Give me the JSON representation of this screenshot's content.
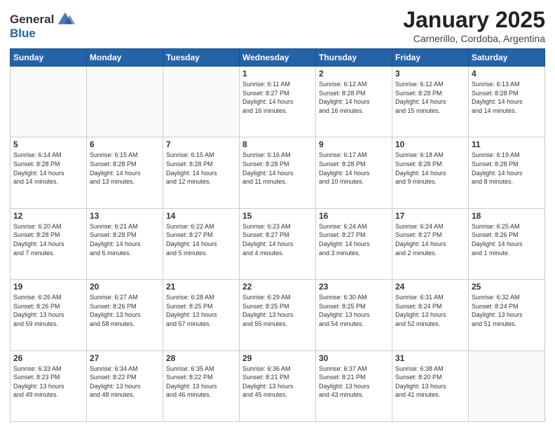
{
  "header": {
    "logo_line1": "General",
    "logo_line2": "Blue",
    "title": "January 2025",
    "subtitle": "Carnerillo, Cordoba, Argentina"
  },
  "weekdays": [
    "Sunday",
    "Monday",
    "Tuesday",
    "Wednesday",
    "Thursday",
    "Friday",
    "Saturday"
  ],
  "weeks": [
    [
      {
        "day": "",
        "info": ""
      },
      {
        "day": "",
        "info": ""
      },
      {
        "day": "",
        "info": ""
      },
      {
        "day": "1",
        "info": "Sunrise: 6:11 AM\nSunset: 8:27 PM\nDaylight: 14 hours\nand 16 minutes."
      },
      {
        "day": "2",
        "info": "Sunrise: 6:12 AM\nSunset: 8:28 PM\nDaylight: 14 hours\nand 16 minutes."
      },
      {
        "day": "3",
        "info": "Sunrise: 6:12 AM\nSunset: 8:28 PM\nDaylight: 14 hours\nand 15 minutes."
      },
      {
        "day": "4",
        "info": "Sunrise: 6:13 AM\nSunset: 8:28 PM\nDaylight: 14 hours\nand 14 minutes."
      }
    ],
    [
      {
        "day": "5",
        "info": "Sunrise: 6:14 AM\nSunset: 8:28 PM\nDaylight: 14 hours\nand 14 minutes."
      },
      {
        "day": "6",
        "info": "Sunrise: 6:15 AM\nSunset: 8:28 PM\nDaylight: 14 hours\nand 13 minutes."
      },
      {
        "day": "7",
        "info": "Sunrise: 6:15 AM\nSunset: 8:28 PM\nDaylight: 14 hours\nand 12 minutes."
      },
      {
        "day": "8",
        "info": "Sunrise: 6:16 AM\nSunset: 8:28 PM\nDaylight: 14 hours\nand 11 minutes."
      },
      {
        "day": "9",
        "info": "Sunrise: 6:17 AM\nSunset: 8:28 PM\nDaylight: 14 hours\nand 10 minutes."
      },
      {
        "day": "10",
        "info": "Sunrise: 6:18 AM\nSunset: 8:28 PM\nDaylight: 14 hours\nand 9 minutes."
      },
      {
        "day": "11",
        "info": "Sunrise: 6:19 AM\nSunset: 8:28 PM\nDaylight: 14 hours\nand 8 minutes."
      }
    ],
    [
      {
        "day": "12",
        "info": "Sunrise: 6:20 AM\nSunset: 8:28 PM\nDaylight: 14 hours\nand 7 minutes."
      },
      {
        "day": "13",
        "info": "Sunrise: 6:21 AM\nSunset: 8:28 PM\nDaylight: 14 hours\nand 6 minutes."
      },
      {
        "day": "14",
        "info": "Sunrise: 6:22 AM\nSunset: 8:27 PM\nDaylight: 14 hours\nand 5 minutes."
      },
      {
        "day": "15",
        "info": "Sunrise: 6:23 AM\nSunset: 8:27 PM\nDaylight: 14 hours\nand 4 minutes."
      },
      {
        "day": "16",
        "info": "Sunrise: 6:24 AM\nSunset: 8:27 PM\nDaylight: 14 hours\nand 3 minutes."
      },
      {
        "day": "17",
        "info": "Sunrise: 6:24 AM\nSunset: 8:27 PM\nDaylight: 14 hours\nand 2 minutes."
      },
      {
        "day": "18",
        "info": "Sunrise: 6:25 AM\nSunset: 8:26 PM\nDaylight: 14 hours\nand 1 minute."
      }
    ],
    [
      {
        "day": "19",
        "info": "Sunrise: 6:26 AM\nSunset: 8:26 PM\nDaylight: 13 hours\nand 59 minutes."
      },
      {
        "day": "20",
        "info": "Sunrise: 6:27 AM\nSunset: 8:26 PM\nDaylight: 13 hours\nand 58 minutes."
      },
      {
        "day": "21",
        "info": "Sunrise: 6:28 AM\nSunset: 8:25 PM\nDaylight: 13 hours\nand 57 minutes."
      },
      {
        "day": "22",
        "info": "Sunrise: 6:29 AM\nSunset: 8:25 PM\nDaylight: 13 hours\nand 55 minutes."
      },
      {
        "day": "23",
        "info": "Sunrise: 6:30 AM\nSunset: 8:25 PM\nDaylight: 13 hours\nand 54 minutes."
      },
      {
        "day": "24",
        "info": "Sunrise: 6:31 AM\nSunset: 8:24 PM\nDaylight: 13 hours\nand 52 minutes."
      },
      {
        "day": "25",
        "info": "Sunrise: 6:32 AM\nSunset: 8:24 PM\nDaylight: 13 hours\nand 51 minutes."
      }
    ],
    [
      {
        "day": "26",
        "info": "Sunrise: 6:33 AM\nSunset: 8:23 PM\nDaylight: 13 hours\nand 49 minutes."
      },
      {
        "day": "27",
        "info": "Sunrise: 6:34 AM\nSunset: 8:22 PM\nDaylight: 13 hours\nand 48 minutes."
      },
      {
        "day": "28",
        "info": "Sunrise: 6:35 AM\nSunset: 8:22 PM\nDaylight: 13 hours\nand 46 minutes."
      },
      {
        "day": "29",
        "info": "Sunrise: 6:36 AM\nSunset: 8:21 PM\nDaylight: 13 hours\nand 45 minutes."
      },
      {
        "day": "30",
        "info": "Sunrise: 6:37 AM\nSunset: 8:21 PM\nDaylight: 13 hours\nand 43 minutes."
      },
      {
        "day": "31",
        "info": "Sunrise: 6:38 AM\nSunset: 8:20 PM\nDaylight: 13 hours\nand 41 minutes."
      },
      {
        "day": "",
        "info": ""
      }
    ]
  ]
}
